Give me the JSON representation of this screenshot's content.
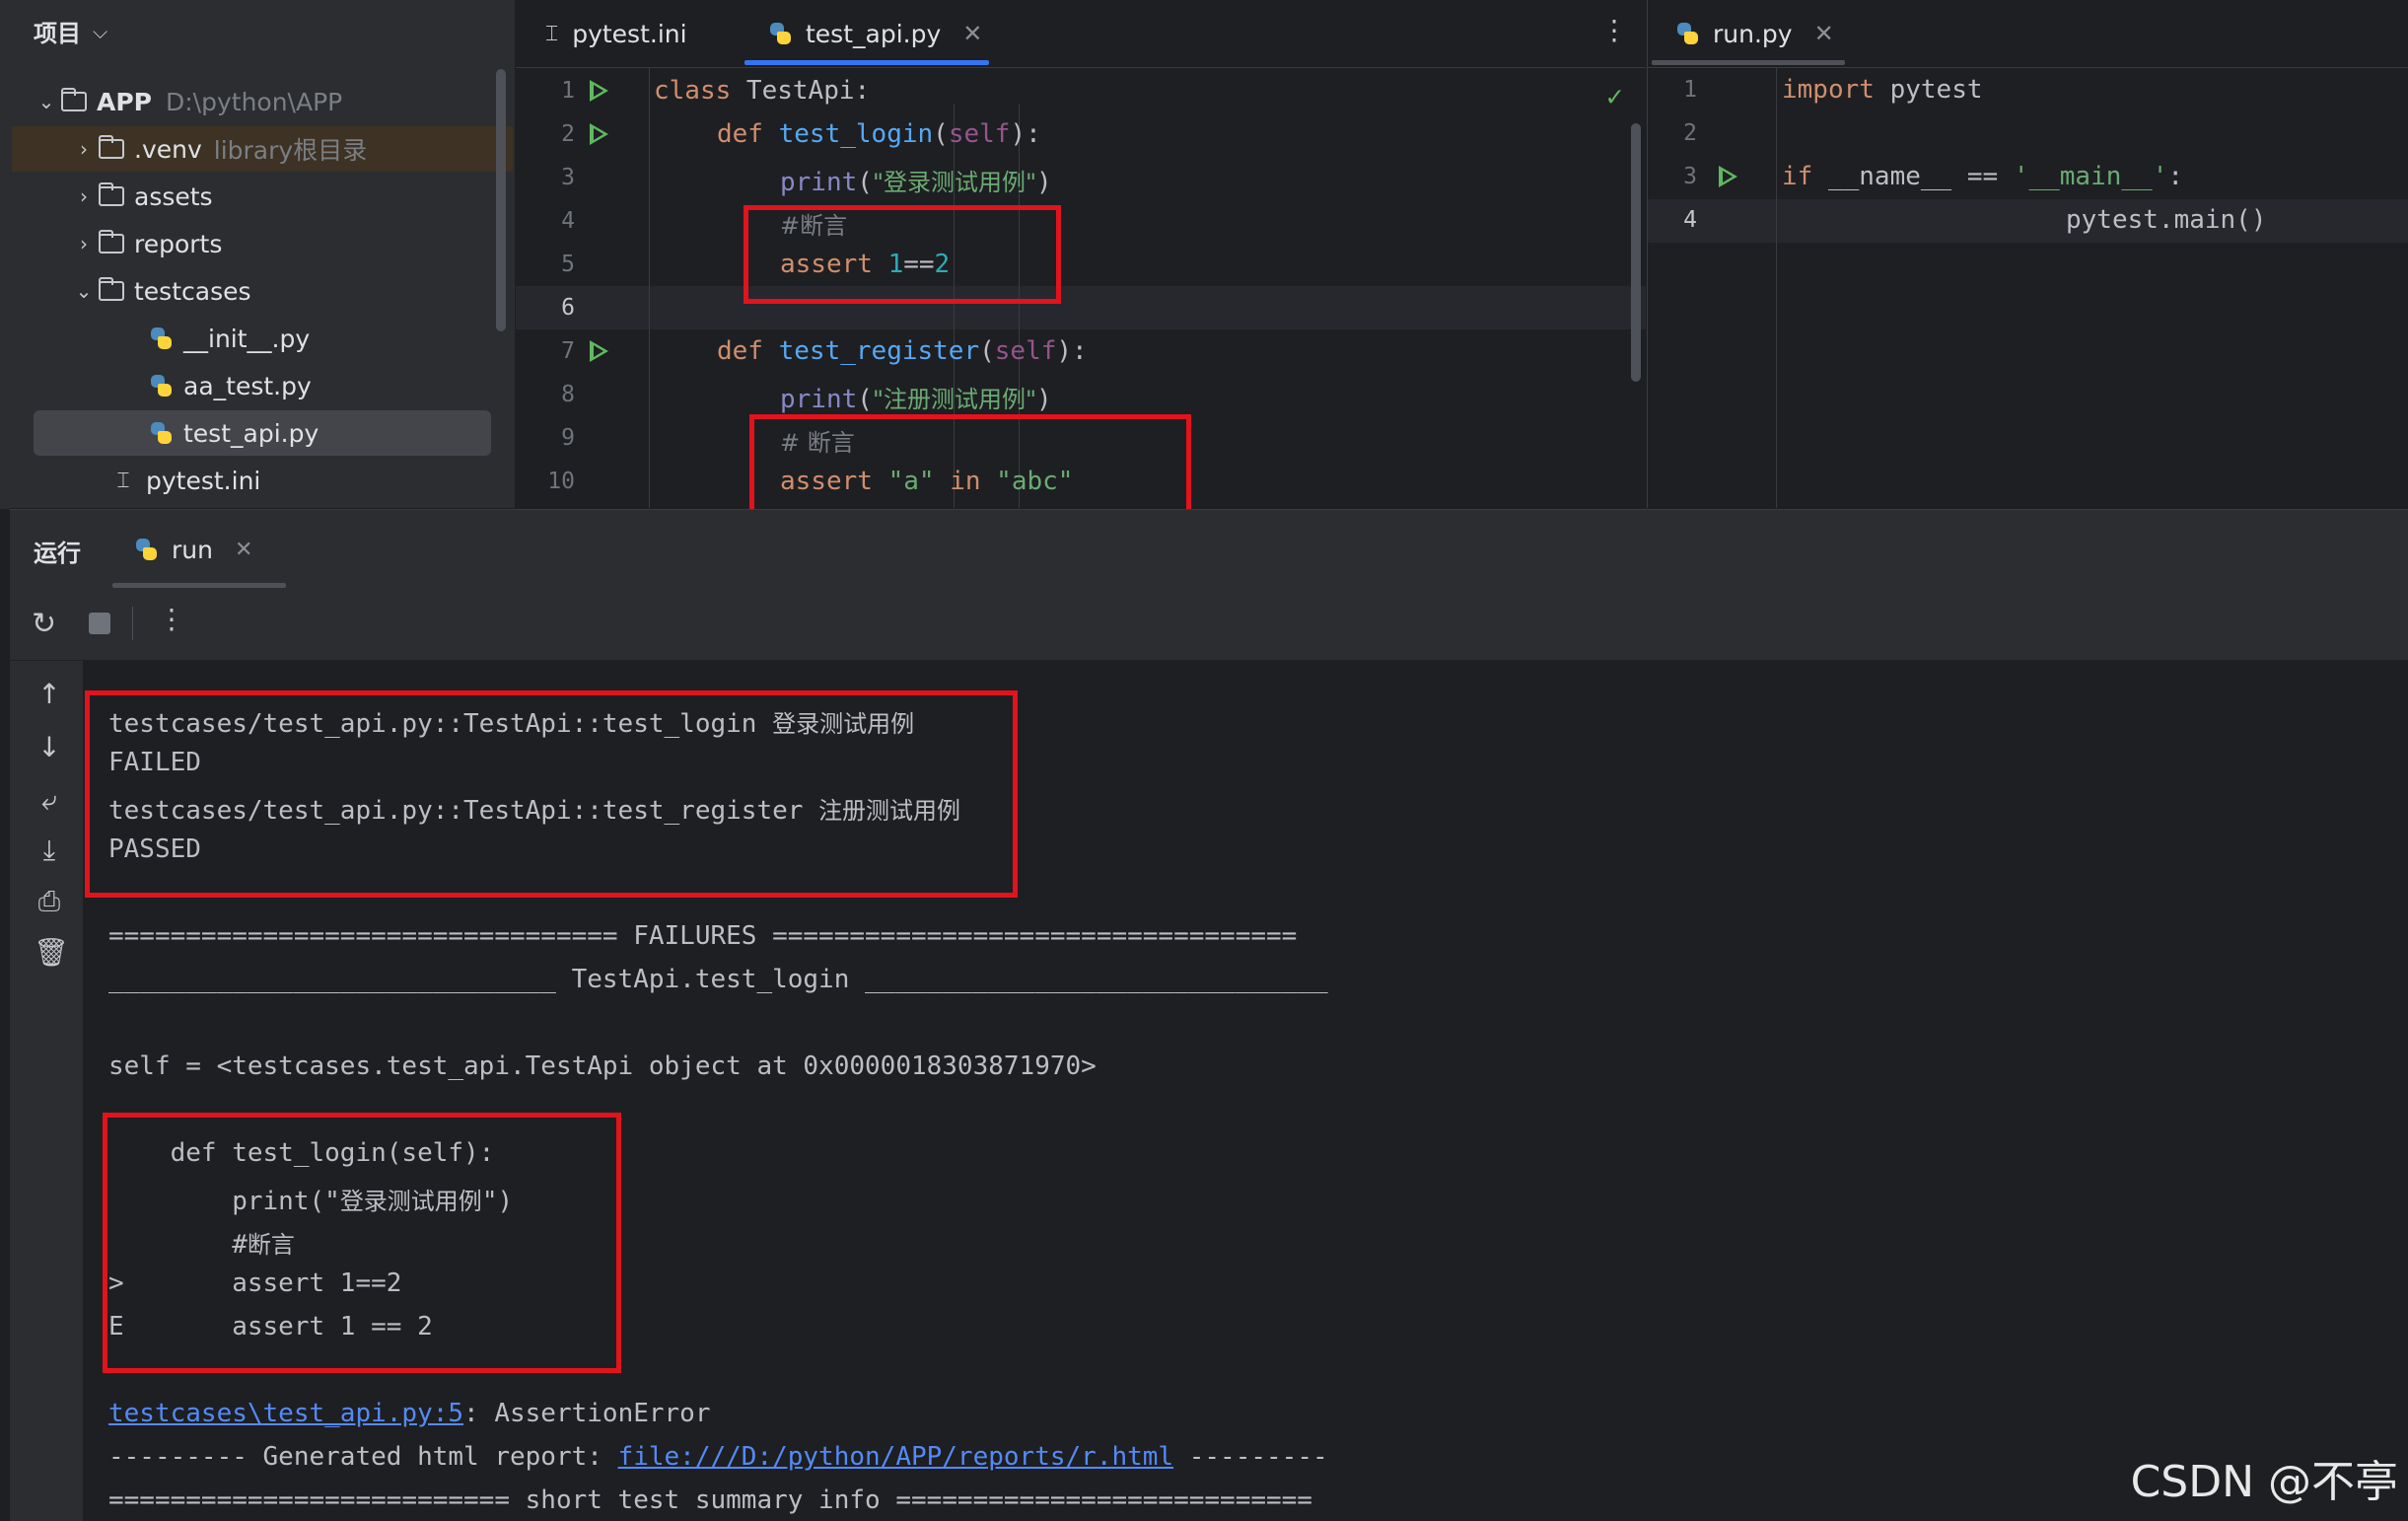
{
  "project": {
    "title": "项目",
    "root": {
      "name": "APP",
      "path": "D:\\python\\APP"
    },
    "items": [
      {
        "name": ".venv",
        "hint": "library根目录"
      },
      {
        "name": "assets"
      },
      {
        "name": "reports"
      },
      {
        "name": "testcases"
      },
      {
        "name": "__init__.py"
      },
      {
        "name": "aa_test.py"
      },
      {
        "name": "test_api.py"
      },
      {
        "name": "pytest.ini"
      }
    ]
  },
  "editor": {
    "tabs": [
      "pytest.ini",
      "test_api.py"
    ],
    "line_numbers": [
      "1",
      "2",
      "3",
      "4",
      "5",
      "6",
      "7",
      "8",
      "9",
      "10"
    ],
    "code": {
      "l1_kw": "class",
      "l1_rest": " TestApi:",
      "l2_kw": "def",
      "l2_fn": "test_login",
      "l2_p1": "(",
      "l2_self": "self",
      "l2_p2": "):",
      "l3_fn": "print",
      "l3_p1": "(",
      "l3_str": "\"登录测试用例\"",
      "l3_p2": ")",
      "l4_cm": "#断言",
      "l5_kw": "assert",
      "l5_n1": "1",
      "l5_op": "==",
      "l5_n2": "2",
      "l7_kw": "def",
      "l7_fn": "test_register",
      "l7_p1": "(",
      "l7_self": "self",
      "l7_p2": "):",
      "l8_fn": "print",
      "l8_p1": "(",
      "l8_str": "\"注册测试用例\"",
      "l8_p2": ")",
      "l9_cm": "# 断言",
      "l10_kw": "assert",
      "l10_s1": "\"a\"",
      "l10_in": " in ",
      "l10_s2": "\"abc\""
    }
  },
  "editor2": {
    "tab": "run.py",
    "line_numbers": [
      "1",
      "2",
      "3",
      "4"
    ],
    "code": {
      "l1_kw": "import",
      "l1_rest": " pytest",
      "l3_kw": "if",
      "l3_rest": " __name__ == ",
      "l3_str": "'__main__'",
      "l3_end": ":",
      "l4": "pytest.main()"
    }
  },
  "run": {
    "title": "运行",
    "tab": "run",
    "console": {
      "c1": "testcases/test_api.py::TestApi::test_login",
      "c1_cn": "登录测试用例",
      "c2": "FAILED",
      "c3": "testcases/test_api.py::TestApi::test_register",
      "c3_cn": "注册测试用例",
      "c4": "PASSED",
      "c5": "================================= FAILURES ==================================",
      "c6": "_____________________________ TestApi.test_login ______________________________",
      "c7": "self = <testcases.test_api.TestApi object at 0x0000018303871970>",
      "c8": "    def test_login(self):",
      "c9a": "        print(\"",
      "c9cn": "登录测试用例",
      "c9b": "\")",
      "c10a": "        #",
      "c10cn": "断言",
      "c11": ">       assert 1==2",
      "c12": "E       assert 1 == 2",
      "c13_link": "testcases\\test_api.py:5",
      "c13_rest": ": AssertionError",
      "c14_a": "--------- Generated html report: ",
      "c14_link": "file:///D:/python/APP/reports/r.html",
      "c14_b": " ---------",
      "c15": "========================== short test summary info ==========================="
    }
  },
  "watermark": "CSDN @不亭",
  "colors": {
    "accent": "#3574f0",
    "annotation": "#e1131d",
    "run_green": "#5fb85f"
  }
}
